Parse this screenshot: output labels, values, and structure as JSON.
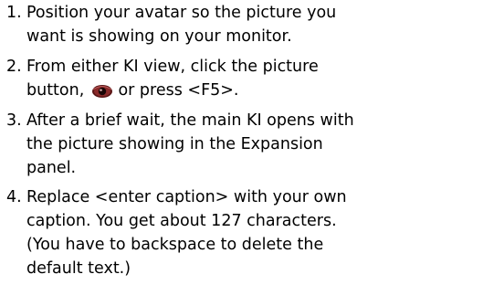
{
  "steps": [
    {
      "number": "1.",
      "lines": [
        "Position your avatar so the picture you",
        "want is showing on your monitor."
      ]
    },
    {
      "number": "2.",
      "lines": [
        "From either KI view, click the picture",
        "button,",
        "or press <F5>."
      ],
      "icon": "eye-icon"
    },
    {
      "number": "3.",
      "lines": [
        "After a brief wait, the main KI opens with",
        "the picture showing in the Expansion",
        "panel."
      ]
    },
    {
      "number": "4.",
      "lines": [
        "Replace <enter caption> with your own",
        "caption. You get about 127 characters.",
        "(You have to backspace to delete the",
        "default text.)"
      ]
    }
  ]
}
